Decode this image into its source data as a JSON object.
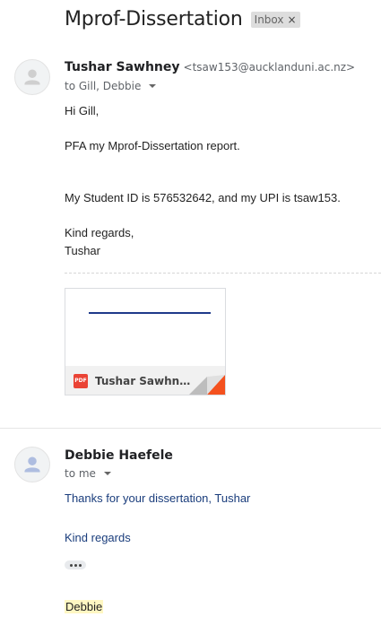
{
  "subject": "Mprof-Dissertation",
  "label": {
    "text": "Inbox",
    "remove": "×"
  },
  "messages": [
    {
      "sender_name": "Tushar Sawhney",
      "sender_email": "<tsaw153@aucklanduni.ac.nz>",
      "to": "to Gill, Debbie",
      "body": [
        "Hi Gill,",
        "PFA my Mprof-Dissertation report.",
        "My Student ID is 576532642, and my UPI is tsaw153.",
        "Kind regards,",
        "Tushar"
      ],
      "attachment": {
        "type": "PDF",
        "name": "Tushar Sawhney M..."
      }
    },
    {
      "sender_name": "Debbie Haefele",
      "to": "to me",
      "body": [
        "Thanks for your dissertation, Tushar",
        "Kind regards"
      ],
      "signature": "Debbie"
    }
  ],
  "colors": {
    "reply_text": "#1a3d7c",
    "pdf_badge": "#ea4335",
    "highlight": "#fff7c2"
  }
}
